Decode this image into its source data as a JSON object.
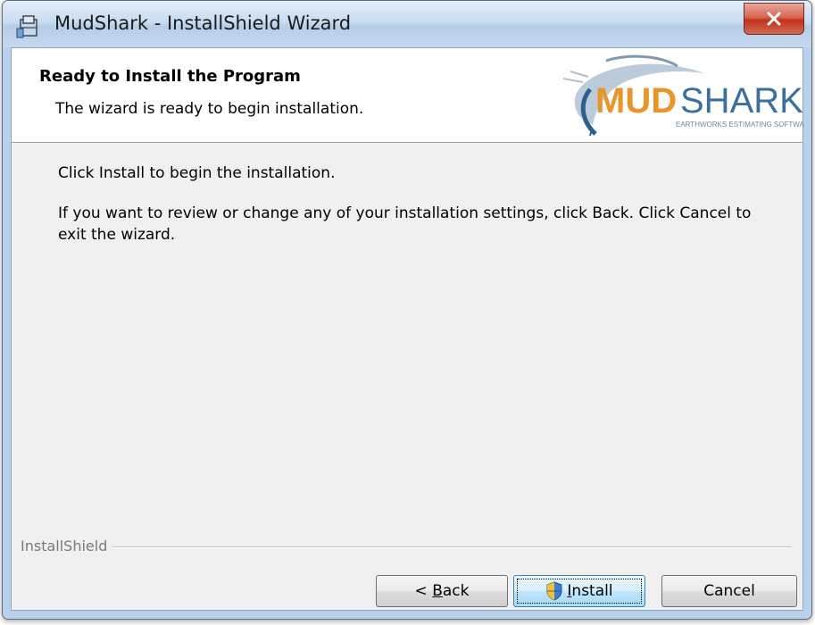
{
  "window": {
    "title": "MudShark - InstallShield Wizard",
    "close_label": "X"
  },
  "banner": {
    "title": "Ready to Install the Program",
    "subtitle": "The wizard is ready to begin installation.",
    "logo": {
      "brand_part1": "MUD",
      "brand_part2": "SHARK",
      "tagline": "EARTHWORKS ESTIMATING SOFTWARE"
    }
  },
  "body": {
    "line1": "Click Install to begin the installation.",
    "line2": "If you want to review or change any of your installation settings, click Back. Click Cancel to exit the wizard."
  },
  "footer": {
    "group_label": "InstallShield"
  },
  "buttons": {
    "back": {
      "prefix": "< ",
      "mnemonic": "B",
      "rest": "ack"
    },
    "install": {
      "mnemonic": "I",
      "rest": "nstall"
    },
    "cancel": "Cancel"
  },
  "colors": {
    "brand_orange": "#e8962a",
    "brand_blue": "#3b6f9e",
    "close_red": "#c2311b"
  }
}
